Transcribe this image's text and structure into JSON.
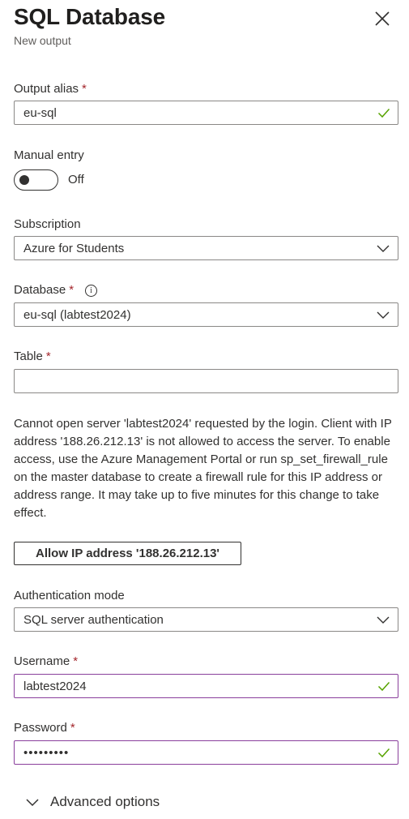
{
  "header": {
    "title": "SQL Database",
    "subtitle": "New output"
  },
  "output_alias": {
    "label": "Output alias",
    "required_marker": "*",
    "value": "eu-sql",
    "valid": true
  },
  "manual_entry": {
    "label": "Manual entry",
    "toggle_state": "Off"
  },
  "subscription": {
    "label": "Subscription",
    "selected": "Azure for Students"
  },
  "database": {
    "label": "Database",
    "required_marker": "*",
    "info_glyph": "i",
    "selected": "eu-sql (labtest2024)"
  },
  "table": {
    "label": "Table",
    "required_marker": "*",
    "value": ""
  },
  "firewall_message": "Cannot open server 'labtest2024' requested by the login. Client with IP address '188.26.212.13' is not allowed to access the server. To enable access, use the Azure Management Portal or run sp_set_firewall_rule on the master database to create a firewall rule for this IP address or address range. It may take up to five minutes for this change to take effect.",
  "allow_ip_button": "Allow IP address '188.26.212.13'",
  "authentication_mode": {
    "label": "Authentication mode",
    "selected": "SQL server authentication"
  },
  "username": {
    "label": "Username",
    "required_marker": "*",
    "value": "labtest2024",
    "valid": true
  },
  "password": {
    "label": "Password",
    "required_marker": "*",
    "masked_value": "•••••••••",
    "valid": true
  },
  "advanced_options": {
    "label": "Advanced options"
  },
  "colors": {
    "valid_check": "#57a300",
    "focus_border": "#8a3f9c",
    "required": "#a4262c"
  },
  "icons": {
    "close": "close-icon",
    "check": "checkmark-icon",
    "dropdown": "chevron-down-icon",
    "info": "info-icon"
  }
}
